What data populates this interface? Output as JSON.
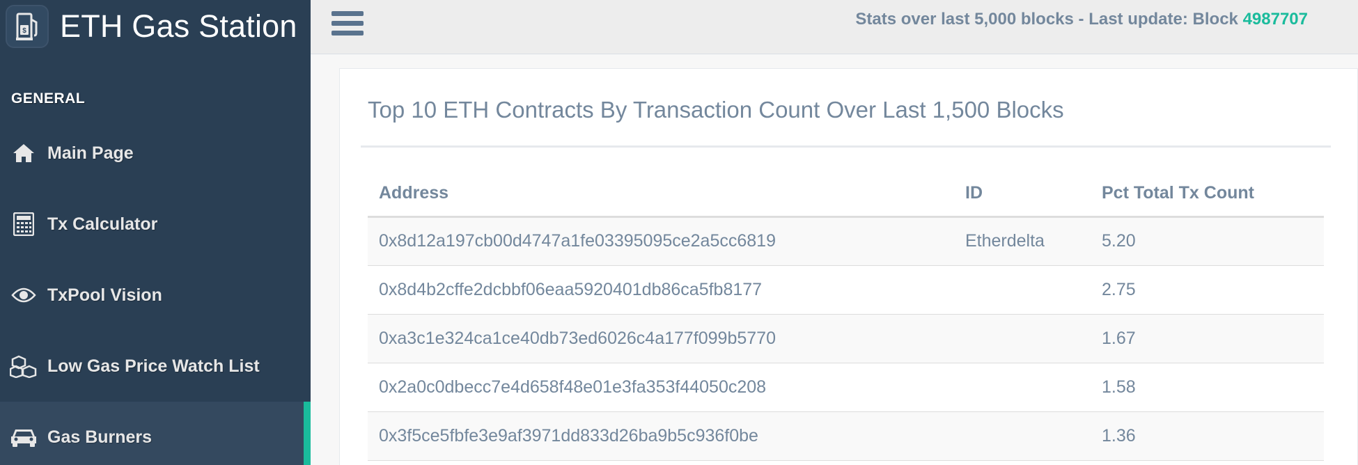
{
  "brand": {
    "title": "ETH Gas Station",
    "icon": "gas-pump-icon"
  },
  "sidebar": {
    "section_title": "GENERAL",
    "items": [
      {
        "label": "Main Page",
        "icon": "home-icon",
        "active": false
      },
      {
        "label": "Tx Calculator",
        "icon": "calculator-icon",
        "active": false
      },
      {
        "label": "TxPool Vision",
        "icon": "eye-icon",
        "active": false
      },
      {
        "label": "Low Gas Price Watch List",
        "icon": "cubes-icon",
        "active": false
      },
      {
        "label": "Gas Burners",
        "icon": "car-icon",
        "active": true
      }
    ]
  },
  "topnav": {
    "menu_icon": "hamburger-menu-icon",
    "stats_prefix": "Stats over last 5,000 blocks - Last update: Block",
    "block_number": "4987707"
  },
  "panel": {
    "title": "Top 10 ETH Contracts By Transaction Count Over Last 1,500 Blocks",
    "columns": [
      "Address",
      "ID",
      "Pct Total Tx Count"
    ],
    "rows": [
      {
        "address": "0x8d12a197cb00d4747a1fe03395095ce2a5cc6819",
        "id": "Etherdelta",
        "pct": "5.20"
      },
      {
        "address": "0x8d4b2cffe2dcbbf06eaa5920401db86ca5fb8177",
        "id": "",
        "pct": "2.75"
      },
      {
        "address": "0xa3c1e324ca1ce40db73ed6026c4a177f099b5770",
        "id": "",
        "pct": "1.67"
      },
      {
        "address": "0x2a0c0dbecc7e4d658f48e01e3fa353f44050c208",
        "id": "",
        "pct": "1.58"
      },
      {
        "address": "0x3f5ce5fbfe3e9af3971dd833d26ba9b5c936f0be",
        "id": "",
        "pct": "1.36"
      }
    ]
  },
  "colors": {
    "sidebar_bg": "#2a3f54",
    "accent": "#1abb9c",
    "text_muted": "#73879c"
  }
}
